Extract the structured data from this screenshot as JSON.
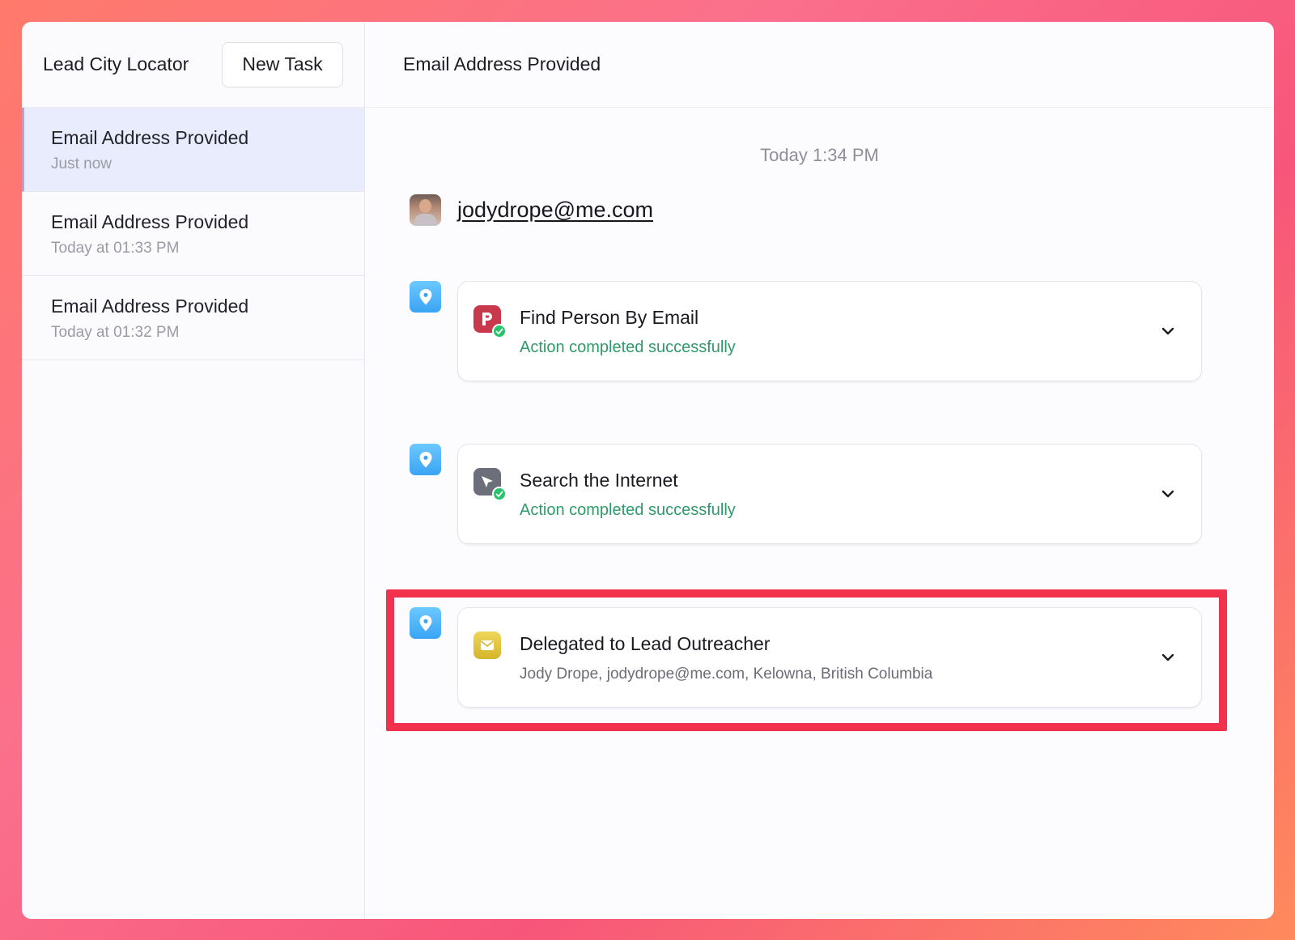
{
  "sidebar": {
    "app_title": "Lead City Locator",
    "new_task_label": "New Task",
    "tasks": [
      {
        "title": "Email Address Provided",
        "time": "Just now",
        "active": true
      },
      {
        "title": "Email Address Provided",
        "time": "Today at 01:33 PM",
        "active": false
      },
      {
        "title": "Email Address Provided",
        "time": "Today at 01:32 PM",
        "active": false
      }
    ]
  },
  "main": {
    "header_title": "Email Address Provided",
    "timestamp": "Today 1:34 PM",
    "user_email": "jodydrope@me.com",
    "steps": [
      {
        "title": "Find Person By Email",
        "status": "Action completed successfully",
        "icon": "find-person-app-icon",
        "icon_color": "#c8394d"
      },
      {
        "title": "Search the Internet",
        "status": "Action completed successfully",
        "icon": "browser-app-icon",
        "icon_color": "#6c6f7a"
      },
      {
        "title": "Delegated to Lead Outreacher",
        "subtitle": "Jody Drope, jodydrope@me.com, Kelowna, British Columbia",
        "icon": "envelope-icon",
        "icon_color": "#e0c63a",
        "highlighted": true
      }
    ]
  },
  "colors": {
    "accent_highlight": "#f2314d",
    "success_text": "#2f9a6a",
    "step_marker": "#3aa4f4",
    "active_task_bg": "#e9ecfc"
  }
}
